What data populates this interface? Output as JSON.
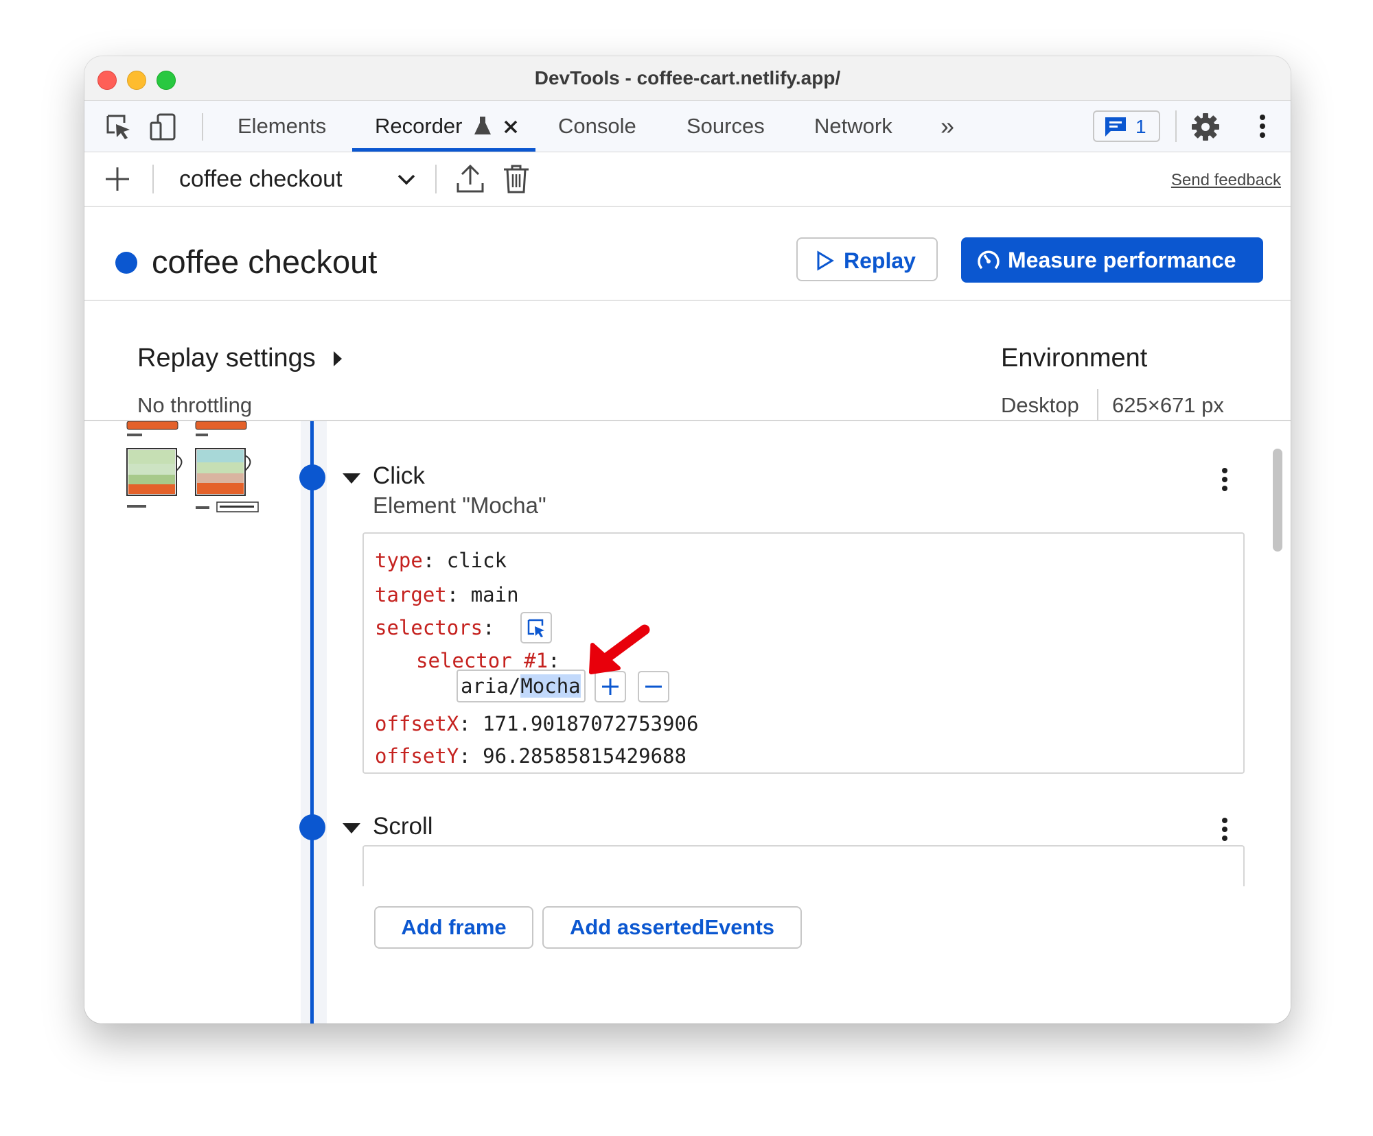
{
  "window": {
    "title": "DevTools - coffee-cart.netlify.app/"
  },
  "tabs": [
    {
      "label": "Elements"
    },
    {
      "label": "Recorder"
    },
    {
      "label": "Console"
    },
    {
      "label": "Sources"
    },
    {
      "label": "Network"
    }
  ],
  "more_tabs_label": "»",
  "issues": {
    "count": "1"
  },
  "toolbar": {
    "recording_name": "coffee checkout",
    "send_feedback": "Send feedback"
  },
  "header": {
    "title": "coffee checkout",
    "replay_label": "Replay",
    "measure_label": "Measure performance"
  },
  "settings": {
    "replay_title": "Replay settings",
    "throttling": "No throttling",
    "environment_title": "Environment",
    "device": "Desktop",
    "viewport": "625×671 px"
  },
  "steps": [
    {
      "title": "Click",
      "subtitle": "Element \"Mocha\"",
      "fields": {
        "type_key": "type",
        "type_val": "click",
        "target_key": "target",
        "target_val": "main",
        "selectors_key": "selectors",
        "selector1_key": "selector #1",
        "selector_plain": "aria/",
        "selector_highlight": "Mocha",
        "offsetX_key": "offsetX",
        "offsetX_val": "171.90187072753906",
        "offsetY_key": "offsetY",
        "offsetY_val": "96.28585815429688"
      },
      "buttons": {
        "add_frame": "Add frame",
        "add_asserted": "Add assertedEvents"
      }
    },
    {
      "title": "Scroll"
    }
  ],
  "colors": {
    "accent": "#0b57d0",
    "code_key": "#c5221f",
    "annotation_arrow": "#e8000b"
  }
}
